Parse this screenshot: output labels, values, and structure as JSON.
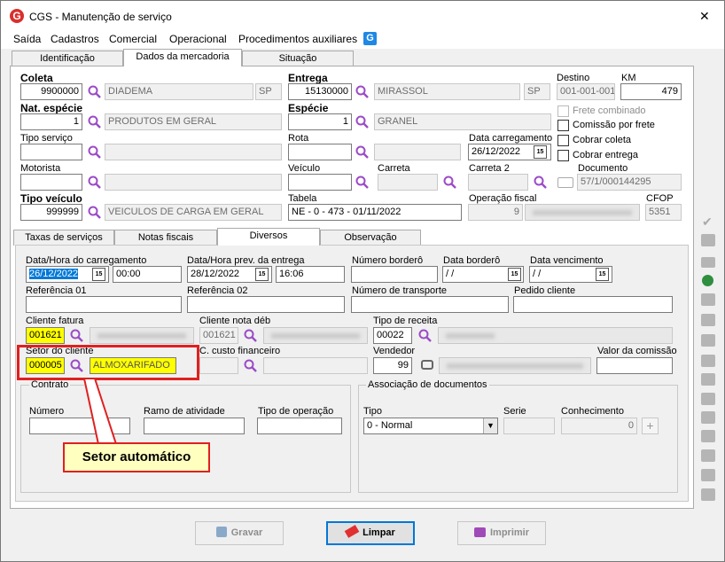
{
  "window": {
    "title": "CGS - Manutenção de serviço",
    "close_glyph": "✕"
  },
  "menu": [
    "Saída",
    "Cadastros",
    "Comercial",
    "Operacional",
    "Procedimentos auxiliares"
  ],
  "top_tabs": [
    "Identificação",
    "Dados da mercadoria",
    "Situação"
  ],
  "coleta": {
    "label": "Coleta",
    "code": "9900000",
    "city": "DIADEMA",
    "uf": "SP"
  },
  "entrega": {
    "label": "Entrega",
    "code": "15130000",
    "city": "MIRASSOL",
    "uf": "SP"
  },
  "destino": {
    "label": "Destino",
    "value": "001-001-001"
  },
  "km": {
    "label": "KM",
    "value": "479"
  },
  "nat_especie": {
    "label": "Nat. espécie",
    "code": "1",
    "desc": "PRODUTOS EM GERAL"
  },
  "especie": {
    "label": "Espécie",
    "code": "1",
    "desc": "GRANEL"
  },
  "checks": {
    "frete_combinado": "Frete combinado",
    "comissao_frete": "Comissão por frete",
    "cobrar_coleta": "Cobrar coleta",
    "cobrar_entrega": "Cobrar entrega"
  },
  "tipo_servico": {
    "label": "Tipo serviço"
  },
  "rota": {
    "label": "Rota"
  },
  "data_carregamento": {
    "label": "Data carregamento",
    "value": "26/12/2022"
  },
  "motorista": {
    "label": "Motorista"
  },
  "veiculo": {
    "label": "Veículo"
  },
  "carreta": {
    "label": "Carreta"
  },
  "carreta2": {
    "label": "Carreta 2"
  },
  "documento": {
    "label": "Documento",
    "value": "57/1/000144295"
  },
  "tipo_veiculo": {
    "label": "Tipo veículo",
    "code": "999999",
    "desc": "VEICULOS DE CARGA EM GERAL"
  },
  "tabela": {
    "label": "Tabela",
    "value": "NE - 0 - 473 - 01/11/2022"
  },
  "operacao_fiscal": {
    "label": "Operação fiscal",
    "value": "9"
  },
  "cfop": {
    "label": "CFOP",
    "value": "5351"
  },
  "bottom_tabs": [
    "Taxas de serviços",
    "Notas fiscais",
    "Diversos",
    "Observação"
  ],
  "diversos": {
    "dh_carregamento": {
      "label": "Data/Hora do carregamento",
      "date": "26/12/2022",
      "time": "00:00"
    },
    "dh_entrega": {
      "label": "Data/Hora prev. da entrega",
      "date": "28/12/2022",
      "time": "16:06"
    },
    "numero_bordero": {
      "label": "Número borderô"
    },
    "data_bordero": {
      "label": "Data borderô",
      "value": " / /"
    },
    "data_vencimento": {
      "label": "Data vencimento",
      "value": " / /"
    },
    "referencia01": {
      "label": "Referência 01"
    },
    "referencia02": {
      "label": "Referência 02"
    },
    "numero_transporte": {
      "label": "Número de transporte"
    },
    "pedido_cliente": {
      "label": "Pedido cliente"
    },
    "cliente_fatura": {
      "label": "Cliente fatura",
      "code": "001621"
    },
    "cliente_nota_deb": {
      "label": "Cliente nota déb",
      "code": "001621"
    },
    "tipo_receita": {
      "label": "Tipo de receita",
      "code": "00022"
    },
    "setor_cliente": {
      "label": "Setor do cliente",
      "code": "000005",
      "desc": "ALMOXARIFADO"
    },
    "c_custo": {
      "label": "C. custo financeiro"
    },
    "vendedor": {
      "label": "Vendedor",
      "code": "99"
    },
    "valor_comissao": {
      "label": "Valor da comissão"
    },
    "contrato": {
      "legend": "Contrato",
      "numero": "Número",
      "ramo": "Ramo de atividade",
      "tipo_operacao": "Tipo de operação"
    },
    "associacao": {
      "legend": "Associação de documentos",
      "tipo_label": "Tipo",
      "tipo_value": "0 - Normal",
      "serie_label": "Serie",
      "conhecimento_label": "Conhecimento",
      "conhecimento_value": "0",
      "add_glyph": "+"
    }
  },
  "callout": {
    "text": "Setor automático"
  },
  "buttons": {
    "gravar": "Gravar",
    "limpar": "Limpar",
    "imprimir": "Imprimir"
  },
  "colors": {
    "highlight": "#ffff00",
    "callout_border": "#e02020",
    "accent": "#0078d7"
  }
}
